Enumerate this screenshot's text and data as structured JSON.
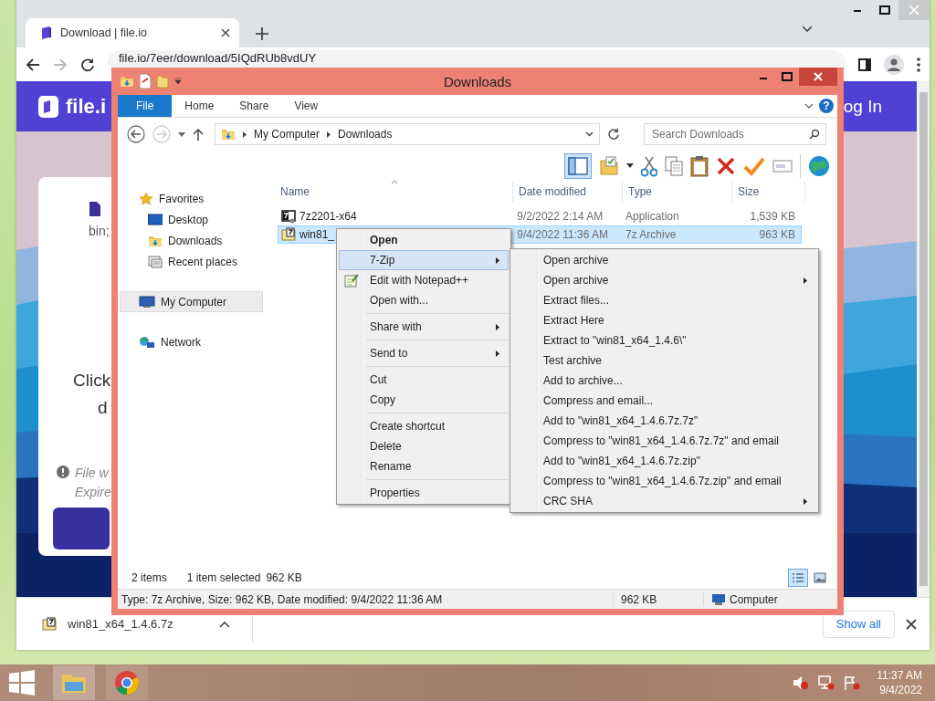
{
  "browser": {
    "tab": {
      "title": "Download | file.io",
      "selected": true
    },
    "url": "file.io/7eer/download/5IQdRUb8vdUY",
    "page": {
      "logo": "file.i",
      "login": "og In",
      "file_meta": "bin;",
      "prompt": [
        "Click",
        "d"
      ],
      "note": [
        "File w",
        "Expire"
      ]
    },
    "download": {
      "file": "win81_x64_1.4.6.7z",
      "show_all": "Show all"
    }
  },
  "explorer": {
    "title": "Downloads",
    "ribbon_tabs": [
      {
        "label": "File",
        "selected": true
      },
      {
        "label": "Home",
        "selected": false
      },
      {
        "label": "Share",
        "selected": false
      },
      {
        "label": "View",
        "selected": false
      }
    ],
    "help": "?",
    "breadcrumb": [
      "My Computer",
      "Downloads"
    ],
    "search": {
      "placeholder": "Search Downloads"
    },
    "preview_pane": {
      "on": true
    },
    "nav": [
      {
        "label": "Favorites",
        "selected": false,
        "children": [
          {
            "label": "Desktop",
            "selected": false
          },
          {
            "label": "Downloads",
            "selected": false
          },
          {
            "label": "Recent places",
            "selected": false
          }
        ]
      },
      {
        "label": "My Computer",
        "selected": true
      },
      {
        "label": "Network",
        "selected": false
      }
    ],
    "columns": [
      "Name",
      "Date modified",
      "Type",
      "Size"
    ],
    "files": [
      {
        "name": "7z2201-x64",
        "date": "9/2/2022 2:14 AM",
        "type": "Application",
        "size": "1,539 KB",
        "selected": false
      },
      {
        "name": "win81_",
        "date": "9/4/2022 11:36 AM",
        "type": "7z Archive",
        "size": "963 KB",
        "selected": true
      }
    ],
    "item_count": "2 items",
    "selection": "1 item selected",
    "selection_size": "962 KB",
    "view_buttons": [
      {
        "selected": true
      },
      {
        "selected": false
      }
    ],
    "details_bar": {
      "info": "Type: 7z Archive, Size: 962 KB, Date modified: 9/4/2022 11:36 AM",
      "size": "962 KB",
      "location": "Computer"
    }
  },
  "context_menu": [
    {
      "kind": "item",
      "label": "Open",
      "bold": true,
      "selected": false,
      "submenu": false,
      "has_icon": false
    },
    {
      "kind": "item",
      "label": "7-Zip",
      "bold": false,
      "selected": true,
      "submenu": true,
      "has_icon": false
    },
    {
      "kind": "item",
      "label": "Edit with Notepad++",
      "bold": false,
      "selected": false,
      "submenu": false,
      "has_icon": true
    },
    {
      "kind": "item",
      "label": "Open with...",
      "bold": false,
      "selected": false,
      "submenu": false,
      "has_icon": false
    },
    {
      "kind": "separator"
    },
    {
      "kind": "item",
      "label": "Share with",
      "bold": false,
      "selected": false,
      "submenu": true,
      "has_icon": false
    },
    {
      "kind": "separator"
    },
    {
      "kind": "item",
      "label": "Send to",
      "bold": false,
      "selected": false,
      "submenu": true,
      "has_icon": false
    },
    {
      "kind": "separator"
    },
    {
      "kind": "item",
      "label": "Cut",
      "bold": false,
      "selected": false,
      "submenu": false,
      "has_icon": false
    },
    {
      "kind": "item",
      "label": "Copy",
      "bold": false,
      "selected": false,
      "submenu": false,
      "has_icon": false
    },
    {
      "kind": "separator"
    },
    {
      "kind": "item",
      "label": "Create shortcut",
      "bold": false,
      "selected": false,
      "submenu": false,
      "has_icon": false
    },
    {
      "kind": "item",
      "label": "Delete",
      "bold": false,
      "selected": false,
      "submenu": false,
      "has_icon": false
    },
    {
      "kind": "item",
      "label": "Rename",
      "bold": false,
      "selected": false,
      "submenu": false,
      "has_icon": false
    },
    {
      "kind": "separator"
    },
    {
      "kind": "item",
      "label": "Properties",
      "bold": false,
      "selected": false,
      "submenu": false,
      "has_icon": false
    }
  ],
  "submenu": [
    {
      "kind": "item",
      "label": "Open archive",
      "selected": false,
      "submenu": false
    },
    {
      "kind": "item",
      "label": "Open archive",
      "selected": false,
      "submenu": true
    },
    {
      "kind": "item",
      "label": "Extract files...",
      "selected": false,
      "submenu": false
    },
    {
      "kind": "item",
      "label": "Extract Here",
      "selected": false,
      "submenu": false
    },
    {
      "kind": "item",
      "label": "Extract to \"win81_x64_1.4.6\\\"",
      "selected": false,
      "submenu": false
    },
    {
      "kind": "item",
      "label": "Test archive",
      "selected": false,
      "submenu": false
    },
    {
      "kind": "item",
      "label": "Add to archive...",
      "selected": false,
      "submenu": false
    },
    {
      "kind": "item",
      "label": "Compress and email...",
      "selected": false,
      "submenu": false
    },
    {
      "kind": "item",
      "label": "Add to \"win81_x64_1.4.6.7z.7z\"",
      "selected": false,
      "submenu": false
    },
    {
      "kind": "item",
      "label": "Compress to \"win81_x64_1.4.6.7z.7z\" and email",
      "selected": false,
      "submenu": false
    },
    {
      "kind": "item",
      "label": "Add to \"win81_x64_1.4.6.7z.zip\"",
      "selected": false,
      "submenu": false
    },
    {
      "kind": "item",
      "label": "Compress to \"win81_x64_1.4.6.7z.zip\" and email",
      "selected": false,
      "submenu": false
    },
    {
      "kind": "item",
      "label": "CRC SHA",
      "selected": false,
      "submenu": true
    }
  ],
  "taskbar": {
    "time": "11:37 AM",
    "date": "9/4/2022"
  }
}
